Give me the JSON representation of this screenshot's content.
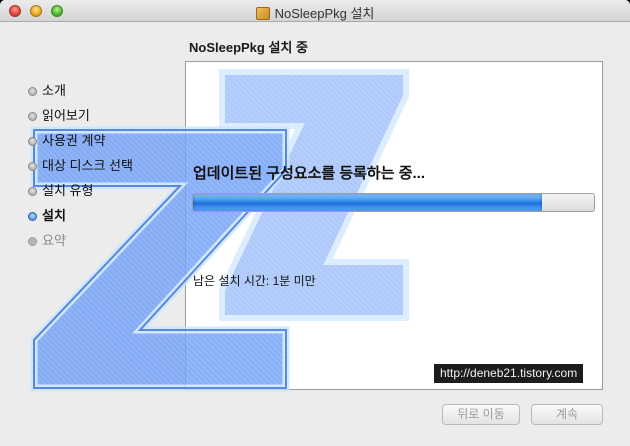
{
  "window": {
    "title": "NoSleepPkg 설치"
  },
  "installer": {
    "heading": "NoSleepPkg 설치 중",
    "steps": [
      {
        "label": "소개",
        "state": "done"
      },
      {
        "label": "읽어보기",
        "state": "done"
      },
      {
        "label": "사용권 계약",
        "state": "done"
      },
      {
        "label": "대상 디스크 선택",
        "state": "done"
      },
      {
        "label": "설치 유형",
        "state": "done"
      },
      {
        "label": "설치",
        "state": "active"
      },
      {
        "label": "요약",
        "state": "future"
      }
    ],
    "status_text": "업데이트된 구성요소를 등록하는 중...",
    "progress": 0.87,
    "time_remaining": "남은 설치 시간: 1분 미만",
    "watermark": "http://deneb21.tistory.com",
    "buttons": {
      "back": "뒤로 이동",
      "next": "계속"
    }
  },
  "colors": {
    "accent": "#3a8ff0",
    "logo_blue": "#5b8ff5"
  }
}
